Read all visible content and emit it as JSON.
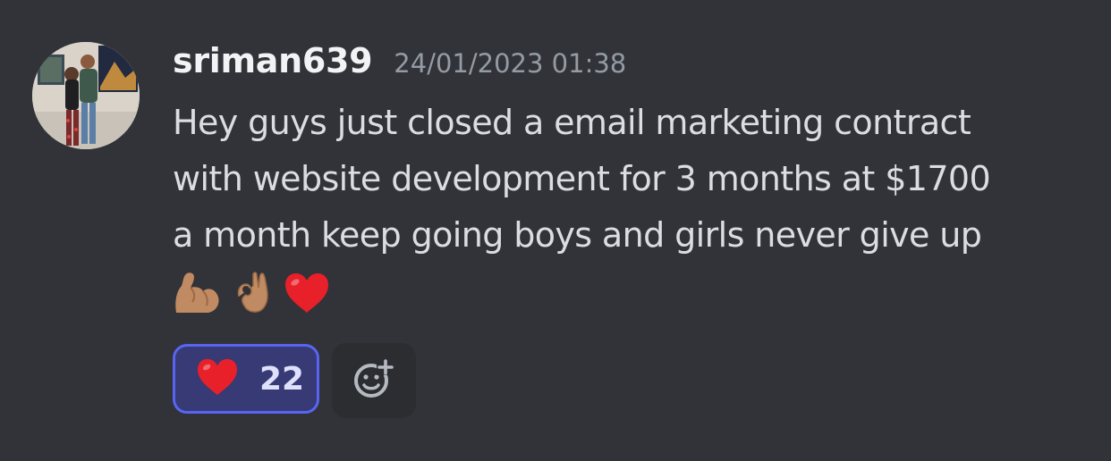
{
  "message": {
    "author": "sriman639",
    "timestamp": "24/01/2023 01:38",
    "content_lines": [
      "Hey guys just closed a email marketing contract",
      "with website development for 3 months at $1700",
      "a month keep going boys and girls never give up"
    ],
    "emojis": [
      "flexed-biceps-medium-skin",
      "ok-hand-medium-skin",
      "red-heart"
    ],
    "avatar_icon": "user-avatar-photo"
  },
  "reactions": [
    {
      "emoji": "red-heart",
      "count": "22",
      "selected": true
    }
  ],
  "add_reaction_icon": "add-reaction-smiley-icon",
  "colors": {
    "background": "#313338",
    "username": "#f2f3f5",
    "timestamp": "#949ba4",
    "text": "#dbdee1",
    "reaction_border": "#5865f2",
    "reaction_bg": "#373a74",
    "heart": "#e8202a"
  }
}
